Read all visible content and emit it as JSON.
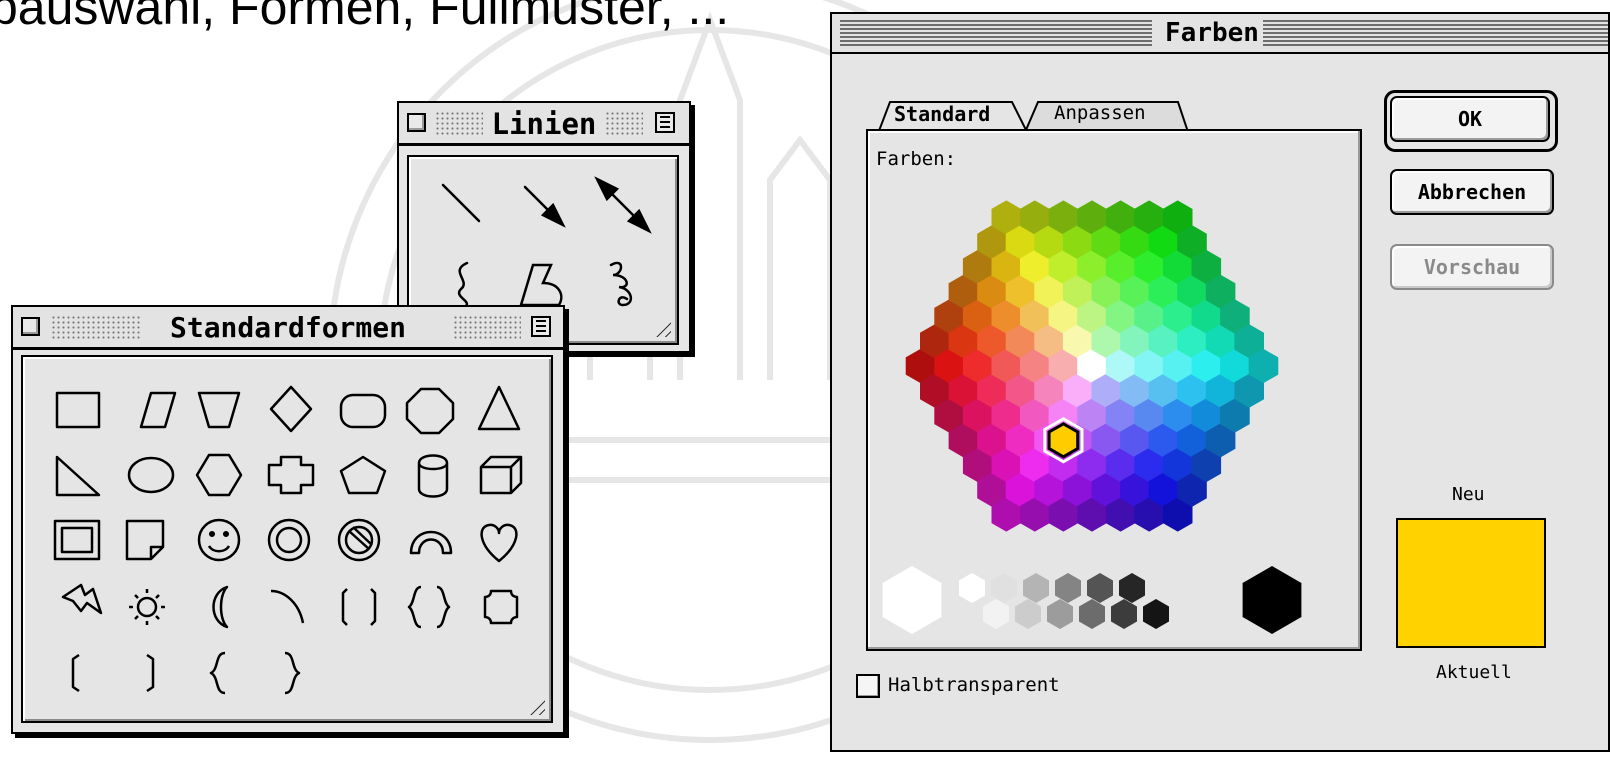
{
  "heading": "bauswahl, Formen, Füllmuster, ...",
  "linien_window": {
    "title": "Linien",
    "tools": [
      "line-tool",
      "arrow-tool",
      "double-arrow-tool",
      "curve-tool",
      "polygon-tool",
      "freehand-tool"
    ]
  },
  "standardformen_window": {
    "title": "Standardformen",
    "shapes": [
      "rectangle",
      "parallelogram",
      "trapezoid",
      "diamond",
      "rounded-rectangle",
      "octagon",
      "triangle",
      "right-triangle",
      "ellipse",
      "hexagon",
      "cross",
      "pentagon",
      "cylinder",
      "cube",
      "frame",
      "folded-corner",
      "smiley",
      "donut",
      "no-symbol",
      "arc",
      "heart",
      "lightning-bolt",
      "sun",
      "moon",
      "arc-line",
      "double-bracket",
      "double-brace",
      "plaque",
      "left-bracket",
      "right-bracket",
      "left-brace",
      "right-brace"
    ]
  },
  "farben_dialog": {
    "title": "Farben",
    "tabs": [
      {
        "label": "Standard",
        "active": true
      },
      {
        "label": "Anpassen",
        "active": false
      }
    ],
    "colors_label": "Farben:",
    "ok_label": "OK",
    "cancel_label": "Abbrechen",
    "preview_label": "Vorschau",
    "new_label": "Neu",
    "current_label": "Aktuell",
    "new_color": "#ffd200",
    "transparent_label": "Halbtransparent",
    "transparent_checked": false,
    "selected_color": "#ffcc00"
  }
}
